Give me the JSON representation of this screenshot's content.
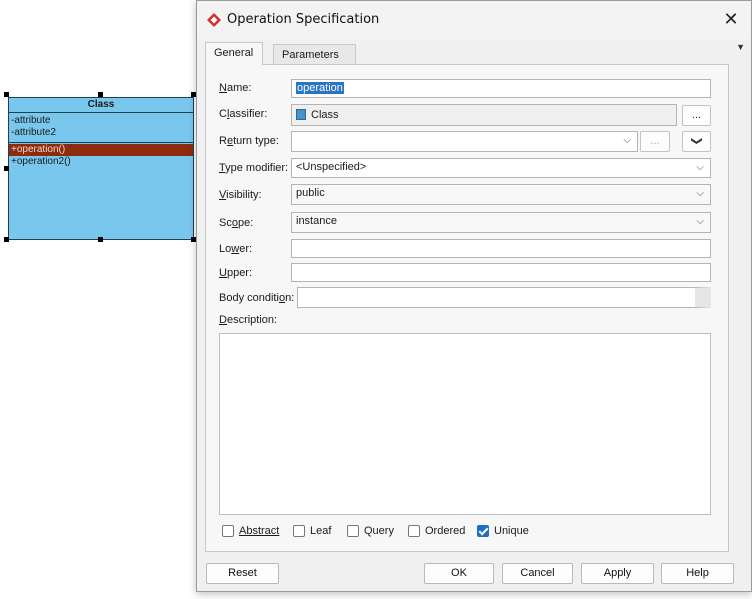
{
  "canvas": {
    "class_name": "Class",
    "attributes": [
      "-attribute",
      "-attribute2"
    ],
    "operations": [
      "+operation()",
      "+operation2()"
    ],
    "fill_color": "#7ac7ee",
    "selected_operation_color": "#8d2c0d"
  },
  "dialog": {
    "title": "Operation Specification",
    "close_glyph": "✕",
    "tabs": [
      "General",
      "Parameters"
    ],
    "tab_menu_glyph": "▼"
  },
  "form": {
    "name_label": "Name:",
    "name_value": "operation",
    "classifier_label": "Classifier:",
    "classifier_value": "Class",
    "classifier_button": "...",
    "return_type_label": "Return type:",
    "return_type_value": "",
    "return_type_browse": "...",
    "return_type_more_glyph": "❯",
    "type_modifier_label": "Type modifier:",
    "type_modifier_value": "<Unspecified>",
    "visibility_label": "Visibility:",
    "visibility_value": "public",
    "scope_label": "Scope:",
    "scope_value": "instance",
    "lower_label": "Lower:",
    "lower_value": "",
    "upper_label": "Upper:",
    "upper_value": "",
    "body_condition_label": "Body condition:",
    "body_condition_value": "",
    "description_label": "Description:",
    "combo_glyph": "⌵"
  },
  "checkboxes": [
    {
      "label": "Abstract",
      "checked": false
    },
    {
      "label": "Leaf",
      "checked": false
    },
    {
      "label": "Query",
      "checked": false
    },
    {
      "label": "Ordered",
      "checked": false
    },
    {
      "label": "Unique",
      "checked": true
    }
  ],
  "buttons": {
    "reset": "Reset",
    "ok": "OK",
    "cancel": "Cancel",
    "apply": "Apply",
    "help": "Help"
  },
  "colors": {
    "accent": "#1b6fc8",
    "brand_icon": "#d3302c"
  }
}
